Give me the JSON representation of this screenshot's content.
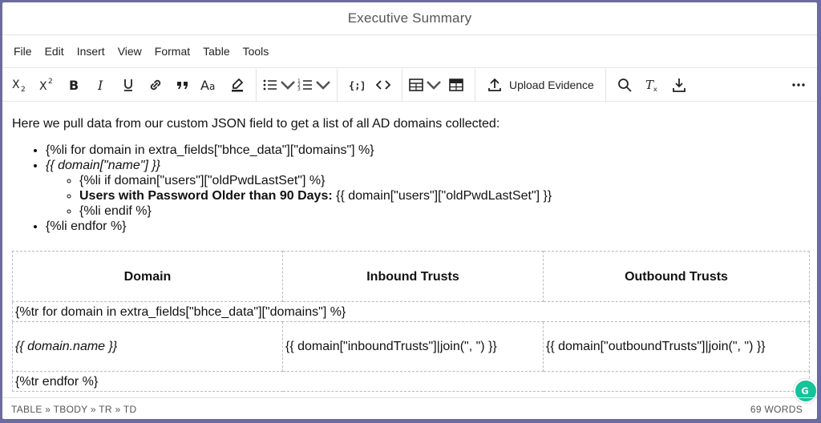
{
  "window": {
    "title": "Executive Summary"
  },
  "menu": [
    "File",
    "Edit",
    "Insert",
    "View",
    "Format",
    "Table",
    "Tools"
  ],
  "toolbar": {
    "upload_label": "Upload Evidence"
  },
  "content": {
    "intro": "Here we pull data from our custom JSON field to get a list of all AD domains collected:",
    "li1": "{%li for domain in extra_fields[\"bhce_data\"][\"domains\"] %}",
    "li2": "{{ domain[\"name\"] }}",
    "sub1": "{%li if domain[\"users\"][\"oldPwdLastSet\"] %}",
    "sub2_bold": "Users with Password Older than 90 Days:",
    "sub2_rest": " {{ domain[\"users\"][\"oldPwdLastSet\"] }}",
    "sub3": "{%li endif %}",
    "li3": "{%li endfor %}"
  },
  "table": {
    "headers": [
      "Domain",
      "Inbound Trusts",
      "Outbound Trusts"
    ],
    "row_for": "{%tr for domain in extra_fields[\"bhce_data\"][\"domains\"] %}",
    "row_cells": [
      "{{ domain.name }}",
      "{{ domain[\"inboundTrusts\"]|join(\", \") }}",
      "{{ domain[\"outboundTrusts\"]|join(\", \") }}"
    ],
    "row_end": "{%tr endfor %}"
  },
  "status": {
    "path": "TABLE » TBODY » TR » TD",
    "words": "69 WORDS"
  },
  "icons": [
    "subscript-icon",
    "superscript-icon",
    "bold-icon",
    "italic-icon",
    "underline-icon",
    "link-icon",
    "quote-icon",
    "font-size-icon",
    "highlight-icon",
    "bullet-list-icon",
    "numbered-list-icon",
    "code-block-icon",
    "code-icon",
    "table-icon",
    "table-alt-icon",
    "upload-icon",
    "search-icon",
    "clear-format-icon",
    "download-icon",
    "more-icon",
    "grammarly-icon"
  ]
}
